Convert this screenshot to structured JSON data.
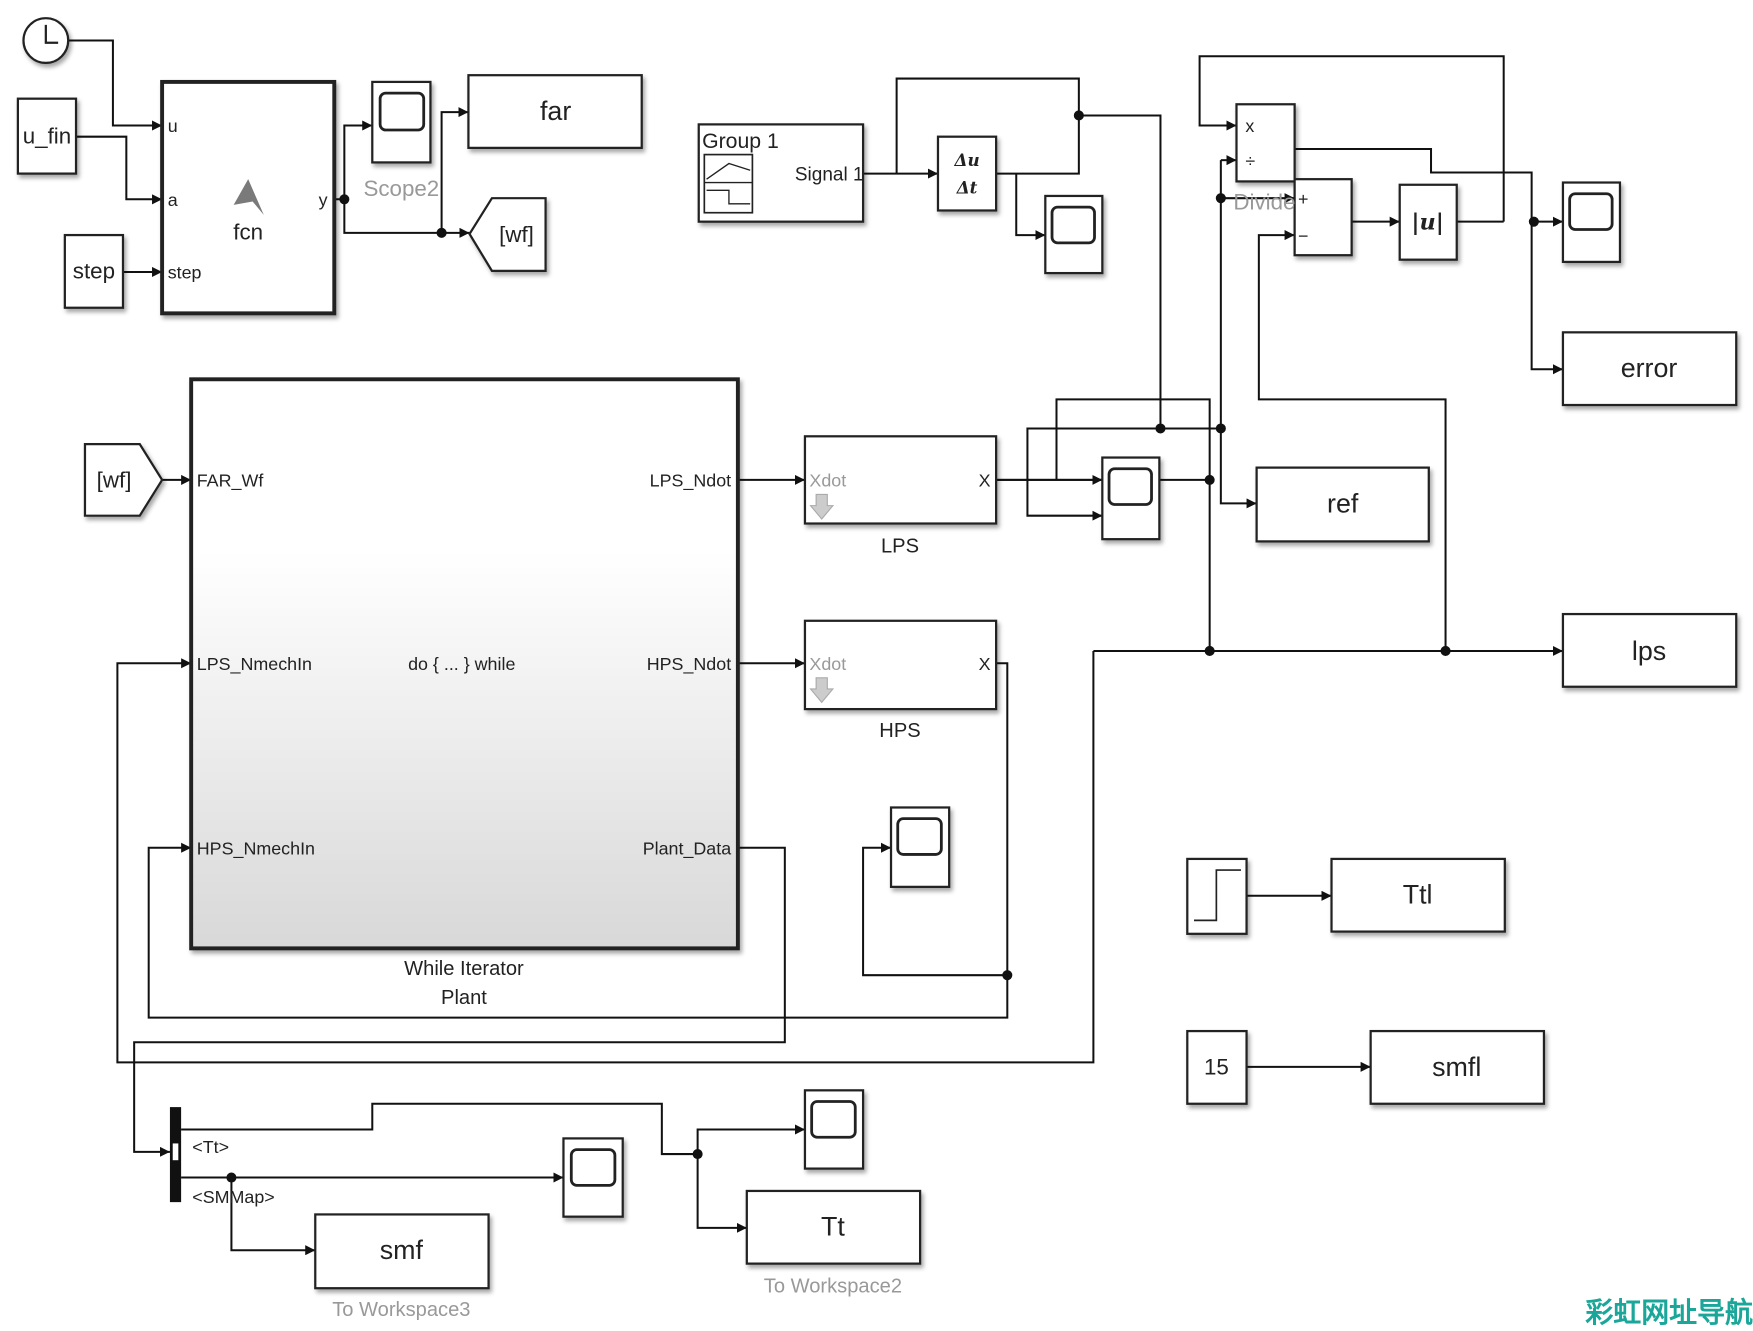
{
  "blocks": {
    "u_fin": "u_fin",
    "step_src": "step",
    "fcn": {
      "name": "fcn",
      "ports_in": [
        "u",
        "a",
        "step"
      ],
      "port_out": "y"
    },
    "scope2": "Scope2",
    "far": "far",
    "goto_wf": "[wf]",
    "signal_builder": {
      "group": "Group 1",
      "signal": "Signal 1"
    },
    "derivative": {
      "num": "Δu",
      "den": "Δt"
    },
    "divide": {
      "name": "Divide",
      "in1": "x",
      "in2": "÷"
    },
    "sum": {
      "plus": "+",
      "minus": "−"
    },
    "abs": "|u|",
    "error": "error",
    "ref": "ref",
    "lps_out": "lps",
    "from_wf": "[wf]",
    "plant": {
      "inputs": [
        "FAR_Wf",
        "LPS_NmechIn",
        "HPS_NmechIn"
      ],
      "outputs": [
        "LPS_Ndot",
        "HPS_Ndot",
        "Plant_Data"
      ],
      "body": "do { ... } while",
      "label1": "While Iterator",
      "label2": "Plant"
    },
    "lps_integrator": {
      "in": "Xdot",
      "out": "X",
      "name": "LPS"
    },
    "hps_integrator": {
      "in": "Xdot",
      "out": "X",
      "name": "HPS"
    },
    "ttl": "Ttl",
    "const15": "15",
    "smfl": "smfl",
    "bus_selector": {
      "sig1": "<Tt>",
      "sig2": "<SMMap>"
    },
    "smf": {
      "var": "smf",
      "name": "To Workspace3"
    },
    "tt": {
      "var": "Tt",
      "name": "To Workspace2"
    }
  },
  "watermark": "彩虹网址导航",
  "colors": {
    "line": "#111111",
    "label_gray": "#999999",
    "watermark": "#1aa79a"
  }
}
